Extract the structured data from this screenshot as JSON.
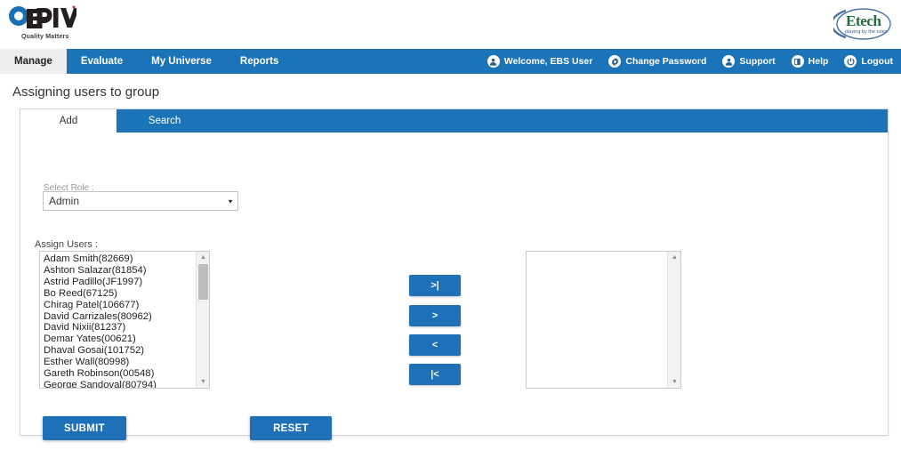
{
  "brand": {
    "primary_blue": "#1b73b8",
    "logo_left": {
      "name": "QEval",
      "tagline": "Quality Matters",
      "icon": "qeval-logo"
    },
    "logo_right": {
      "name": "Etech",
      "tagline": "playing by the rules",
      "icon": "etech-logo"
    }
  },
  "nav": {
    "items": [
      {
        "label": "Manage",
        "active": true
      },
      {
        "label": "Evaluate",
        "active": false
      },
      {
        "label": "My Universe",
        "active": false
      },
      {
        "label": "Reports",
        "active": false
      }
    ],
    "utilities": [
      {
        "label": "Welcome, EBS User",
        "icon": "user-icon"
      },
      {
        "label": "Change Password",
        "icon": "gear-icon"
      },
      {
        "label": "Support",
        "icon": "user-icon"
      },
      {
        "label": "Help",
        "icon": "book-icon"
      },
      {
        "label": "Logout",
        "icon": "power-icon"
      }
    ]
  },
  "page": {
    "title": "Assigning users to group"
  },
  "tabs": [
    {
      "label": "Add",
      "active": true
    },
    {
      "label": "Search",
      "active": false
    }
  ],
  "form": {
    "role": {
      "label": "Select Role :",
      "value": "Admin",
      "caret": "▾"
    },
    "assign": {
      "label": "Assign Users :",
      "available_users": [
        "Adam Smith(82669)",
        "Ashton Salazar(81854)",
        "Astrid Padillo(JF1997)",
        "Bo Reed(67125)",
        "Chirag Patel(106677)",
        "David Carrizales(80962)",
        "David Nixii(81237)",
        "Demar Yates(00621)",
        "Dhaval Gosai(101752)",
        "Esther Wall(80998)",
        "Gareth Robinson(00548)",
        "George Sandoval(80794)"
      ],
      "selected_users": []
    },
    "transfer_buttons": [
      {
        "label": ">|",
        "name": "move-all-right"
      },
      {
        "label": ">",
        "name": "move-right"
      },
      {
        "label": "<",
        "name": "move-left"
      },
      {
        "label": "|<",
        "name": "move-all-left"
      }
    ],
    "actions": {
      "submit": "SUBMIT",
      "reset": "RESET"
    }
  },
  "scroll": {
    "up_arrow": "▲",
    "down_arrow": "▼"
  }
}
